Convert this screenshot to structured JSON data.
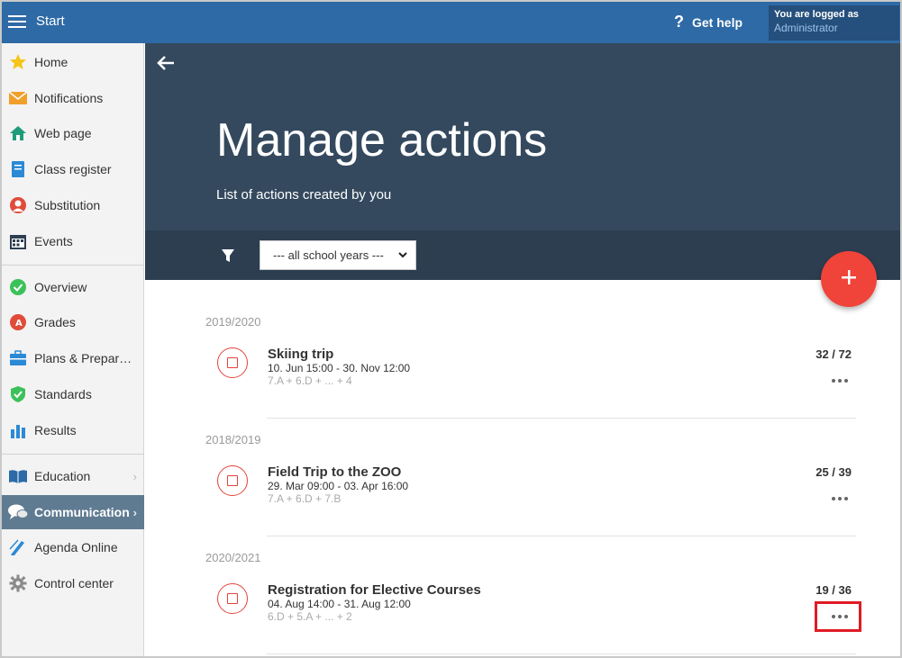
{
  "topbar": {
    "start_label": "Start",
    "help_icon": "?",
    "help_label": "Get help",
    "logged_as_label": "You are logged as",
    "user_role": "Administrator"
  },
  "sidebar": {
    "items": [
      {
        "label": "Home",
        "icon": "star-icon"
      },
      {
        "label": "Notifications",
        "icon": "envelope-icon"
      },
      {
        "label": "Web page",
        "icon": "house-icon"
      },
      {
        "label": "Class register",
        "icon": "notebook-icon"
      },
      {
        "label": "Substitution",
        "icon": "person-swap-icon"
      },
      {
        "label": "Events",
        "icon": "calendar-icon"
      },
      {
        "label": "Overview",
        "icon": "check-circle-icon"
      },
      {
        "label": "Grades",
        "icon": "grade-icon"
      },
      {
        "label": "Plans & Preparations",
        "icon": "briefcase-icon"
      },
      {
        "label": "Standards",
        "icon": "shield-check-icon"
      },
      {
        "label": "Results",
        "icon": "bar-chart-icon"
      },
      {
        "label": "Education",
        "icon": "book-icon"
      },
      {
        "label": "Communication",
        "icon": "chat-icon"
      },
      {
        "label": "Agenda Online",
        "icon": "pen-icon"
      },
      {
        "label": "Control center",
        "icon": "gear-icon"
      }
    ],
    "chevron": "›"
  },
  "hero": {
    "title": "Manage actions",
    "subtitle": "List of actions created by you"
  },
  "filter": {
    "selected": "--- all school years ---"
  },
  "fab_icon": "plus-icon",
  "groups": [
    {
      "year": "2019/2020",
      "action": {
        "title": "Skiing trip",
        "dates": "10. Jun 15:00 - 30. Nov 12:00",
        "classes": "7.A + 6.D + ... + 4",
        "count": "32 / 72"
      }
    },
    {
      "year": "2018/2019",
      "action": {
        "title": "Field Trip to the ZOO",
        "dates": "29. Mar 09:00 - 03. Apr 16:00",
        "classes": "7.A + 6.D + 7.B",
        "count": "25 / 39"
      }
    },
    {
      "year": "2020/2021",
      "action": {
        "title": "Registration for Elective Courses",
        "dates": "04. Aug 14:00 - 31. Aug 12:00",
        "classes": "6.D + 5.A + ... + 2",
        "count": "19 / 36"
      }
    }
  ],
  "colors": {
    "topbar": "#2e6aa6",
    "hero": "#34495e",
    "filter_bar": "#2c3e50",
    "accent_red": "#f0433a",
    "sidebar_active": "#5f7b92"
  }
}
